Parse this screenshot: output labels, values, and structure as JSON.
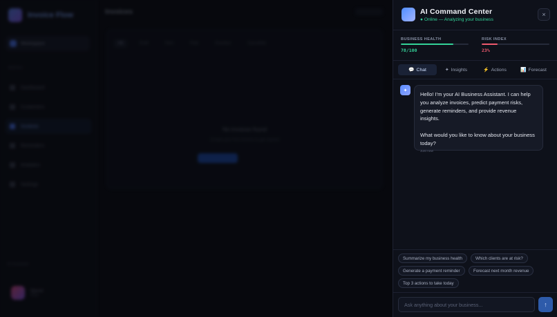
{
  "background_app": {
    "brand": "Invoice Flow",
    "workspace": "Workspace",
    "nav_section": "MENU",
    "nav_items": [
      "Dashboard",
      "Customers",
      "Invoices",
      "Reminders",
      "Analytics",
      "Settings"
    ],
    "sidebar_bottom": "AI Assistant",
    "user_name": "Name",
    "user_sub": "Plan",
    "main_title": "Invoices",
    "filters": [
      "All",
      "Draft",
      "Sent",
      "Paid",
      "Overdue",
      "Cancelled"
    ],
    "empty_title": "No invoices found",
    "empty_sub": "Create your first invoice to get started"
  },
  "ai_panel": {
    "title": "AI Command Center",
    "status": "● Online — Analyzing your business",
    "close_icon": "×",
    "metrics": {
      "health": {
        "label": "BUSINESS HEALTH",
        "value": "78/100",
        "fraction": 0.78,
        "color": "#34d399"
      },
      "risk": {
        "label": "RISK INDEX",
        "value": "23%",
        "fraction": 0.23,
        "color": "#f05a6e"
      }
    },
    "tabs": [
      {
        "icon": "💬",
        "label": "Chat"
      },
      {
        "icon": "✦",
        "label": "Insights"
      },
      {
        "icon": "⚡",
        "label": "Actions"
      },
      {
        "icon": "📊",
        "label": "Forecast"
      }
    ],
    "message": {
      "avatar_icon": "✦",
      "line1": "Hello! I'm your AI Business Assistant. I can help you analyze invoices, predict payment risks, generate reminders, and provide revenue insights.",
      "line2": "What would you like to know about your business today?",
      "time": "Just now"
    },
    "suggestions": [
      "Summarize my business health",
      "Which clients are at risk?",
      "Generate a payment reminder",
      "Forecast next month revenue",
      "Top 3 actions to take today"
    ],
    "input_placeholder": "Ask anything about your business...",
    "send_icon": "↑"
  }
}
